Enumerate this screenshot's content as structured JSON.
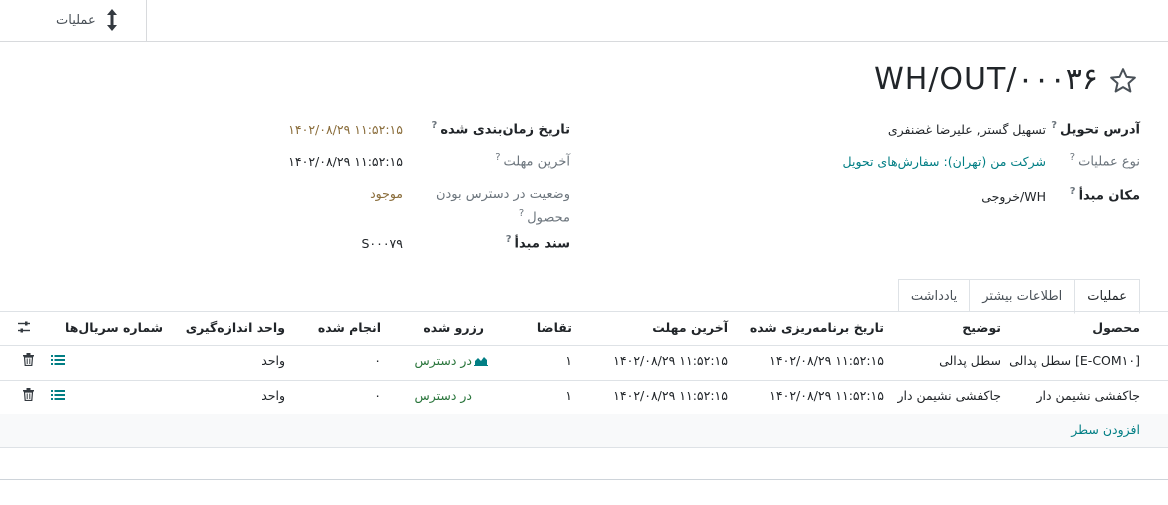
{
  "toolbar": {
    "operations_label": "عملیات"
  },
  "record": {
    "title": "WH/OUT/۰۰۰۳۶"
  },
  "fields_right": {
    "delivery_address": {
      "label": "آدرس تحویل",
      "help": "?",
      "value": "تسهیل گستر, علیرضا غضنفری"
    },
    "operation_type": {
      "label": "نوع عملیات",
      "help": "?",
      "value": "شرکت من (تهران): سفارش‌های تحویل"
    },
    "source_location": {
      "label": "مکان مبدأ",
      "help": "?",
      "value": "WH/خروجی"
    }
  },
  "fields_left": {
    "scheduled_date": {
      "label": "تاریخ زمان‌بندی شده",
      "help": "?",
      "value": "۱۴۰۲/۰۸/۲۹ ۱۱:۵۲:۱۵"
    },
    "deadline": {
      "label": "آخرین مهلت",
      "help": "?",
      "value": "۱۴۰۲/۰۸/۲۹ ۱۱:۵۲:۱۵"
    },
    "availability": {
      "label_line1": "وضعیت در دسترس بودن",
      "label_line2": "محصول",
      "help": "?",
      "value": "موجود"
    },
    "source_document": {
      "label": "سند مبدأ",
      "help": "?",
      "value": "S۰۰۰۷۹"
    }
  },
  "tabs": [
    {
      "label": "عملیات",
      "active": true
    },
    {
      "label": "اطلاعات بیشتر",
      "active": false
    },
    {
      "label": "یادداشت",
      "active": false
    }
  ],
  "table": {
    "headers": {
      "product": "محصول",
      "description": "توضیح",
      "scheduled_date": "تاریخ برنامه‌ریزی شده",
      "deadline": "آخرین مهلت",
      "demand": "تقاضا",
      "reserved": "رزرو شده",
      "done": "انجام شده",
      "uom": "واحد اندازه‌گیری",
      "serials": "شماره سریال‌ها"
    },
    "rows": [
      {
        "product": "[E-COM۱۰] سطل پدالی",
        "description": "سطل پدالی",
        "scheduled_date": "۱۴۰۲/۰۸/۲۹ ۱۱:۵۲:۱۵",
        "deadline": "۱۴۰۲/۰۸/۲۹ ۱۱:۵۲:۱۵",
        "demand": "۱",
        "reserved": "در دسترس",
        "done": "۰",
        "uom": "واحد"
      },
      {
        "product": "جاکفشی نشیمن دار",
        "description": "جاکفشی نشیمن دار",
        "scheduled_date": "۱۴۰۲/۰۸/۲۹ ۱۱:۵۲:۱۵",
        "deadline": "۱۴۰۲/۰۸/۲۹ ۱۱:۵۲:۱۵",
        "demand": "۱",
        "reserved": "در دسترس",
        "done": "۰",
        "uom": "واحد"
      }
    ],
    "add_line_label": "افزودن سطر"
  },
  "colors": {
    "link": "#017e84",
    "available_green": "#28743a",
    "brown_value": "#8a6d3b"
  },
  "icons": [
    "updown-arrow-icon",
    "star-icon",
    "settings-sliders-icon",
    "chart-icon",
    "list-details-icon",
    "trash-icon"
  ]
}
